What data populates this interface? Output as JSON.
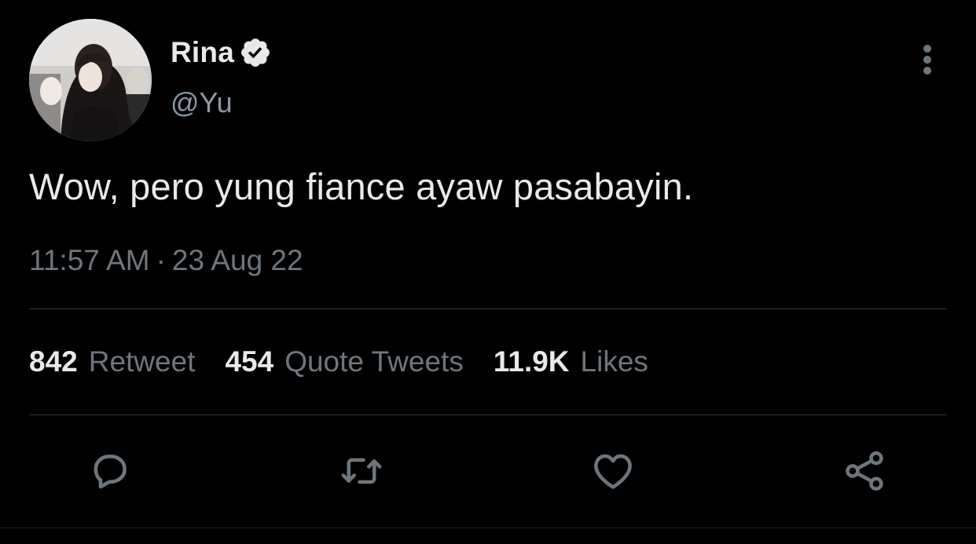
{
  "author": {
    "display_name": "Rina",
    "handle": "@Yu",
    "verified": true
  },
  "tweet": {
    "text": "Wow, pero yung fiance ayaw pasabayin.",
    "time": "11:57 AM",
    "separator": "·",
    "date": "23 Aug 22"
  },
  "stats": [
    {
      "count": "842",
      "label": "Retweet"
    },
    {
      "count": "454",
      "label": "Quote Tweets"
    },
    {
      "count": "11.9K",
      "label": "Likes"
    }
  ],
  "actions": {
    "reply": "reply-icon",
    "retweet": "retweet-icon",
    "like": "heart-icon",
    "share": "share-icon"
  },
  "colors": {
    "background": "#000000",
    "text": "#e7e9ea",
    "secondary": "#6e767d",
    "divider": "#2f3336"
  }
}
